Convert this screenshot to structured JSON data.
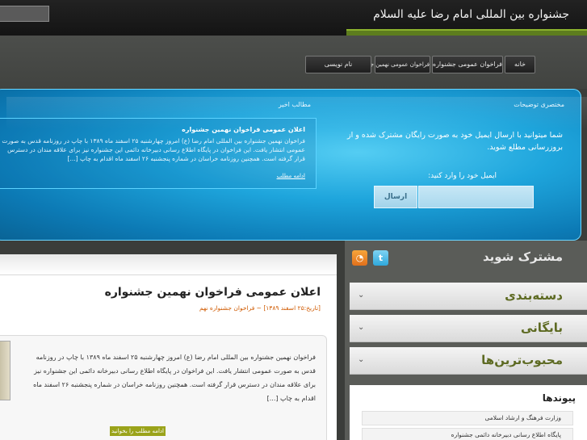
{
  "header": {
    "site_title": "جشنواره بین المللی امام رضا علیه السلام"
  },
  "nav": {
    "items": [
      {
        "label": "خانه"
      },
      {
        "label": "فراخوان عمومی جشنواره"
      },
      {
        "label": "فراخوان عمومی نهمین جشنواره"
      },
      {
        "label": "نام نویسی"
      }
    ]
  },
  "featured": {
    "description_heading": "مختصری توضیحات",
    "description_text": "شما میتوانید با ارسال ایمیل خود به صورت رایگان مشترک شده و از بروزرسانی مطلع شوید.",
    "email_label": "ایمیل خود را وارد کنید:",
    "email_value": "",
    "send_label": "ارسال",
    "recent_heading": "مطالب اخیر",
    "recent_title": "اعلان عمومی فراخوان نهمین جشنواره",
    "recent_excerpt": "فراخوان نهمین جشنواره بین المللی امام رضا (ع) امروز چهارشنبه ۲۵ اسفند ماه ۱۳۸۹ با چاپ در روزنامه قدس به صورت عمومی انتشار یافت. این فراخوان در پایگاه اطلاع رسانی دبیرخانه دائمی این جشنواره نیز برای علاقه مندان در دسترس قرار گرفته است. همچنین روزنامه خراسان در شماره پنجشنبه ۲۶ اسفند ماه اقدام به چاپ [...]",
    "recent_more": "ادامه مطلب"
  },
  "post": {
    "title": "اعلان عمومی فراخوان نهمین جشنواره",
    "meta": "[تاریخ:۲۵ اسفند ۱۳۸۹] ~ فراخوان جشنواره نهم",
    "body": "فراخوان نهمین جشنواره بین المللی امام رضا (ع) امروز چهارشنبه ۲۵ اسفند ماه ۱۳۸۹ با چاپ در روزنامه قدس به صورت عمومی انتشار یافت. این فراخوان در پایگاه اطلاع رسانی دبیرخانه دائمی این جشنواره نیز برای علاقه مندان در دسترس قرار گرفته است. همچنین روزنامه خراسان در شماره پنجشنبه ۲۶ اسفند ماه اقدام به چاپ [...]",
    "read_more": "ادامه مطلب را بخوانید"
  },
  "sidebar": {
    "subscribe_label": "مشترک شوید",
    "categories_label": "دسته‌بندی",
    "archive_label": "بایگانی",
    "popular_label": "محبوب‌ترین‌ها",
    "links_title": "پیوندها",
    "links": [
      {
        "label": "وزارت فرهنگ و ارشاد اسلامی"
      },
      {
        "label": "پایگاه اطلاع رسانی دبیرخانه دائمی جشنواره"
      }
    ],
    "rss_icon": "rss-icon",
    "twitter_icon": "twitter-icon"
  },
  "colors": {
    "accent_green": "#5d7d1e",
    "panel_blue": "#1ea5dc",
    "sidebar_heading": "#5d6a22"
  }
}
